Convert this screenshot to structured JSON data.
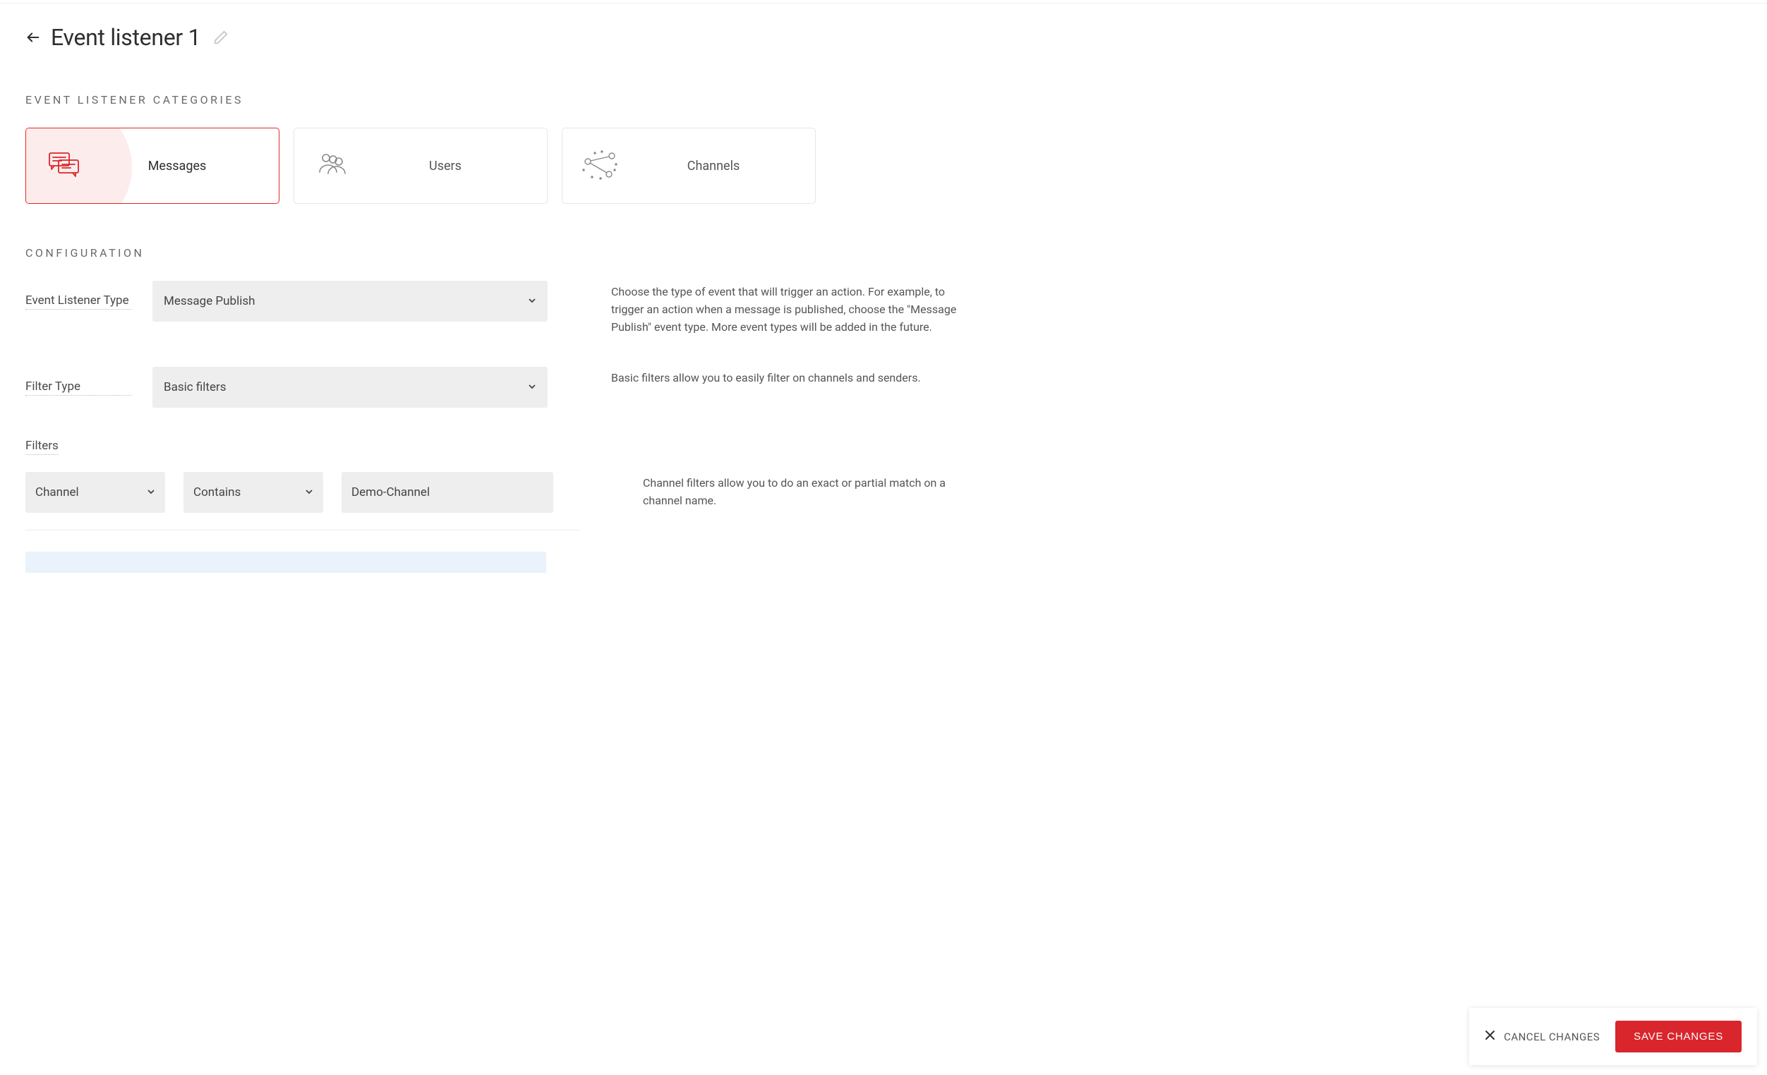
{
  "header": {
    "title": "Event listener 1"
  },
  "sections": {
    "categories_heading": "EVENT LISTENER CATEGORIES",
    "configuration_heading": "CONFIGURATION"
  },
  "categories": [
    {
      "label": "Messages",
      "active": true
    },
    {
      "label": "Users",
      "active": false
    },
    {
      "label": "Channels",
      "active": false
    }
  ],
  "config": {
    "event_type": {
      "label": "Event Listener Type",
      "value": "Message Publish",
      "help": "Choose the type of event that will trigger an action. For example, to trigger an action when a message is published, choose the \"Message Publish\" event type. More event types will be added in the future."
    },
    "filter_type": {
      "label": "Filter Type",
      "value": "Basic filters",
      "help": "Basic filters allow you to easily filter on channels and senders."
    },
    "filters": {
      "label": "Filters",
      "field": "Channel",
      "operator": "Contains",
      "value": "Demo-Channel",
      "help": "Channel filters allow you to do an exact or partial match on a channel name."
    }
  },
  "actions": {
    "cancel": "CANCEL CHANGES",
    "save": "SAVE CHANGES"
  }
}
